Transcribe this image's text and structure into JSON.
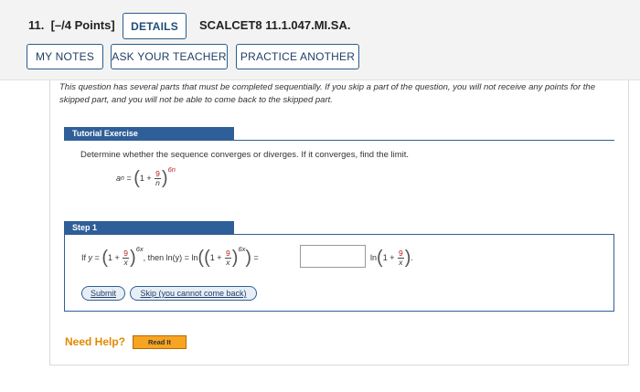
{
  "question": {
    "number": "11.",
    "points": "[–/4 Points]",
    "code": "SCALCET8 11.1.047.MI.SA."
  },
  "buttons": {
    "details": "DETAILS",
    "my_notes": "MY NOTES",
    "ask_teacher": "ASK YOUR TEACHER",
    "practice_another": "PRACTICE ANOTHER"
  },
  "intro": "This question has several parts that must be completed sequentially. If you skip a part of the question, you will not receive any points for the skipped part, and you will not be able to come back to the skipped part.",
  "tutorial": {
    "header": "Tutorial Exercise",
    "prompt": "Determine whether the sequence converges or diverges. If it converges, find the limit.",
    "formula": {
      "lhs": "a",
      "lhs_sub": "n",
      "equals": "=",
      "one_plus": "1 +",
      "num": "9",
      "den": "n",
      "exp": "6n"
    }
  },
  "step1": {
    "header": "Step 1",
    "if": "If",
    "y": "y",
    "equals": "=",
    "one_plus": "1 +",
    "num": "9",
    "den": "x",
    "exp": "6x",
    "then": ", then",
    "ln_y": "ln(y) = ln",
    "answer_value": "",
    "ln2": "ln",
    "end": ".",
    "submit": "Submit",
    "skip": "Skip (you cannot come back)"
  },
  "help": {
    "label": "Need Help?",
    "read_it": "Read It"
  },
  "colors": {
    "accent": "#2f5f98",
    "fraction_numerator": "#b22222",
    "help": "#e08a00",
    "read_it_bg": "#f7a421"
  }
}
